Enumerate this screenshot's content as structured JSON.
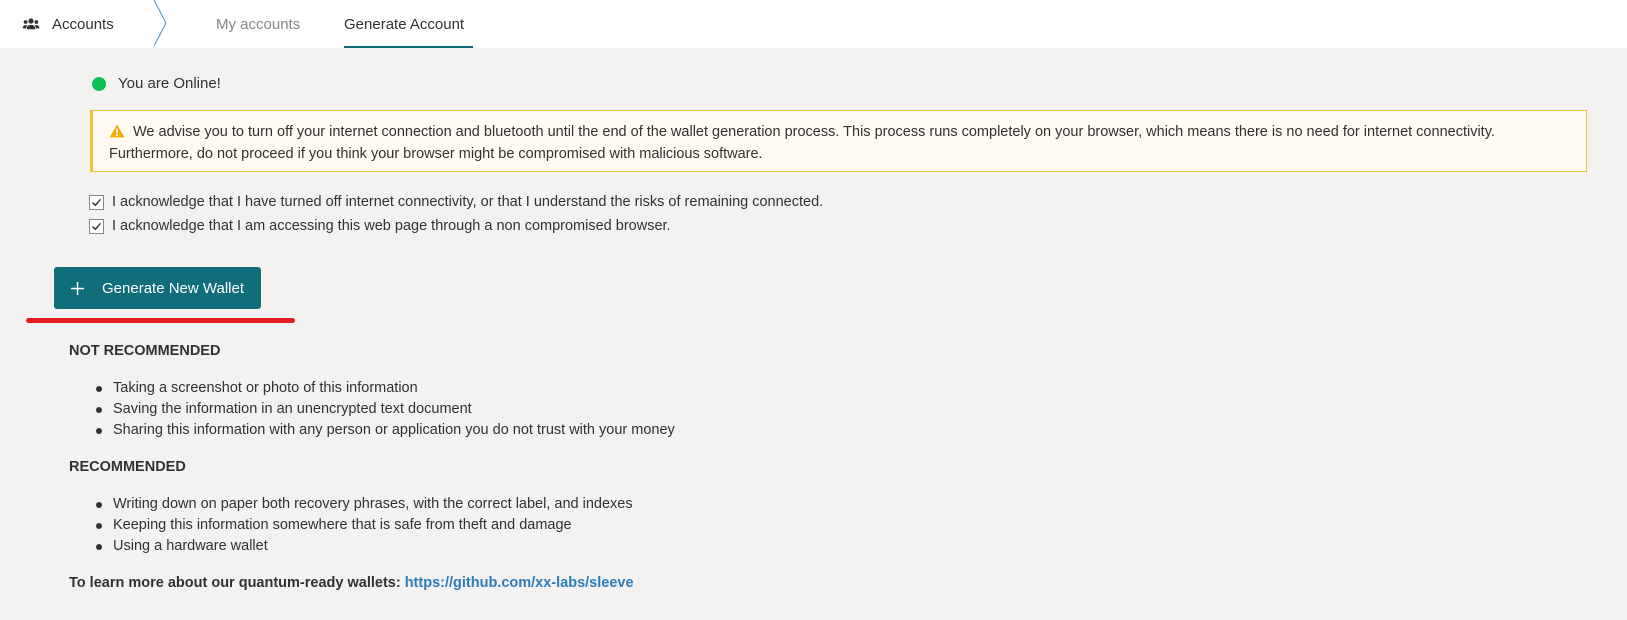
{
  "nav": {
    "breadcrumb_label": "Accounts",
    "tabs": [
      {
        "label": "My accounts",
        "active": false
      },
      {
        "label": "Generate Account",
        "active": true
      }
    ]
  },
  "status": {
    "text": "You are Online!",
    "color": "#0bc155"
  },
  "warning": {
    "text": "We advise you to turn off your internet connection and bluetooth until the end of the wallet generation process. This process runs completely on your browser, which means there is no need for internet connectivity. Furthermore, do not proceed if you think your browser might be compromised with malicious software."
  },
  "acknowledgements": [
    {
      "label": "I acknowledge that I have turned off internet connectivity, or that I understand the risks of remaining connected.",
      "checked": true
    },
    {
      "label": "I acknowledge that I am accessing this web page through a non compromised browser.",
      "checked": true
    }
  ],
  "generate_button": {
    "label": "Generate New Wallet",
    "icon": "plus-icon",
    "color": "#0f6e7a"
  },
  "not_recommended": {
    "title": "NOT RECOMMENDED",
    "items": [
      "Taking a screenshot or photo of this information",
      "Saving the information in an unencrypted text document",
      "Sharing this information with any person or application you do not trust with your money"
    ]
  },
  "recommended": {
    "title": "RECOMMENDED",
    "items": [
      "Writing down on paper both recovery phrases, with the correct label, and indexes",
      "Keeping this information somewhere that is safe from theft and damage",
      "Using a hardware wallet"
    ]
  },
  "learn_more": {
    "prefix": "To learn more about our quantum-ready wallets:",
    "link_text": "https://github.com/xx-labs/sleeve"
  },
  "colors": {
    "accent": "#0f6e7a",
    "warning_border": "#f2c335",
    "highlight": "#e51c23",
    "link": "#2b7cb8"
  }
}
